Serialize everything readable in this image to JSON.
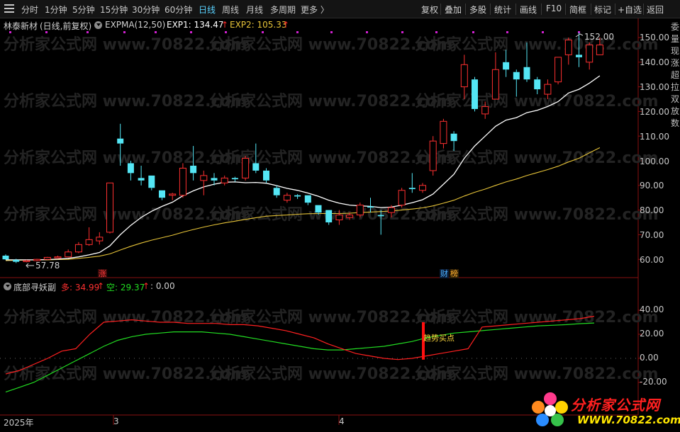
{
  "toolbar": {
    "periods": [
      {
        "label": "分时"
      },
      {
        "label": "1分钟"
      },
      {
        "label": "5分钟"
      },
      {
        "label": "15分钟"
      },
      {
        "label": "30分钟"
      },
      {
        "label": "60分钟"
      },
      {
        "label": "日线",
        "active": true
      },
      {
        "label": "周线"
      },
      {
        "label": "月线"
      },
      {
        "label": "多周期"
      },
      {
        "label": "更多 〉"
      }
    ],
    "right_buttons": [
      "复权",
      "叠加",
      "多股",
      "统计",
      "画线",
      "F10",
      "简框",
      "标记",
      "+自选",
      "返回"
    ]
  },
  "main_header": {
    "stock_name": "林泰新材",
    "mode": "(日线,前复权)",
    "indicator": "EXPMA(12,50)",
    "exp1_label": "EXP1: 134.47",
    "exp2_label": "EXP2: 105.33",
    "up_arrow": "↑"
  },
  "sub_header": {
    "name": "底部寻妖副",
    "long_label": "多: 34.99",
    "short_label": "空: 29.37",
    "signal_label": ": 0.00",
    "up_arrow": "↑"
  },
  "price_axis": [
    "150.00",
    "140.00",
    "130.00",
    "120.00",
    "110.00",
    "100.00",
    "90.00",
    "80.00",
    "70.00",
    "60.00"
  ],
  "sub_axis": [
    "40.00",
    "20.00",
    "0.00",
    "-20.00"
  ],
  "annotations": {
    "high": "152.00",
    "low": "57.78",
    "badge_zhang": "涨",
    "badge_cai": "财",
    "badge_bang": "榜",
    "signal_text": "趋势买点"
  },
  "date_axis": [
    "2025年",
    "3",
    "4"
  ],
  "watermark": "分析家公式网 www.70822.com",
  "logo": {
    "title": "分析家公式网",
    "url": "WWW.70822.com"
  },
  "side_strip": [
    "委",
    "量",
    "现",
    "涨",
    "超",
    "拉",
    "双",
    "放",
    "数"
  ],
  "colors": {
    "up": "#ff3030",
    "down": "#54e6f5",
    "exp1": "#ffffff",
    "exp2": "#e6c338",
    "long_line": "#ff2020",
    "short_line": "#22dd22",
    "signal_bar": "#ff1010",
    "active_tab": "#5ad2ff",
    "marker": "#d020d0"
  },
  "chart_data": {
    "type": "candlestick",
    "ylim": [
      55,
      156
    ],
    "candles": [
      {
        "o": 61.5,
        "c": 60.0,
        "h": 62.0,
        "l": 59.8
      },
      {
        "o": 59.8,
        "c": 59.0,
        "h": 60.2,
        "l": 58.5
      },
      {
        "o": 59.2,
        "c": 59.5,
        "h": 59.8,
        "l": 58.8
      },
      {
        "o": 59.5,
        "c": 60.0,
        "h": 60.2,
        "l": 59.2
      },
      {
        "o": 60.0,
        "c": 60.8,
        "h": 61.0,
        "l": 59.8
      },
      {
        "o": 60.8,
        "c": 61.0,
        "h": 61.5,
        "l": 60.5
      },
      {
        "o": 61.0,
        "c": 63.0,
        "h": 64.0,
        "l": 60.8
      },
      {
        "o": 63.0,
        "c": 66.0,
        "h": 67.0,
        "l": 62.5
      },
      {
        "o": 66.0,
        "c": 68.0,
        "h": 73.0,
        "l": 65.5
      },
      {
        "o": 67.5,
        "c": 69.0,
        "h": 71.0,
        "l": 66.0
      },
      {
        "o": 71.0,
        "c": 91.0,
        "h": 91.0,
        "l": 70.5
      },
      {
        "o": 109.0,
        "c": 107.0,
        "h": 115.0,
        "l": 98.0
      },
      {
        "o": 99.0,
        "c": 95.0,
        "h": 100.0,
        "l": 92.0
      },
      {
        "o": 93.0,
        "c": 92.0,
        "h": 98.0,
        "l": 90.0
      },
      {
        "o": 94.0,
        "c": 89.0,
        "h": 94.0,
        "l": 88.0
      },
      {
        "o": 88.0,
        "c": 85.0,
        "h": 88.0,
        "l": 84.0
      },
      {
        "o": 86.0,
        "c": 86.5,
        "h": 87.0,
        "l": 84.0
      },
      {
        "o": 86.0,
        "c": 97.0,
        "h": 99.0,
        "l": 85.0
      },
      {
        "o": 98.0,
        "c": 95.0,
        "h": 106.0,
        "l": 92.0
      },
      {
        "o": 92.0,
        "c": 94.0,
        "h": 96.0,
        "l": 86.0
      },
      {
        "o": 93.0,
        "c": 92.0,
        "h": 95.0,
        "l": 90.0
      },
      {
        "o": 91.0,
        "c": 93.0,
        "h": 94.0,
        "l": 90.0
      },
      {
        "o": 93.0,
        "c": 92.5,
        "h": 93.5,
        "l": 91.5
      },
      {
        "o": 93.0,
        "c": 101.0,
        "h": 102.0,
        "l": 92.0
      },
      {
        "o": 99.0,
        "c": 96.0,
        "h": 107.0,
        "l": 95.0
      },
      {
        "o": 96.0,
        "c": 92.0,
        "h": 97.0,
        "l": 91.0
      },
      {
        "o": 89.0,
        "c": 86.0,
        "h": 90.0,
        "l": 85.0
      },
      {
        "o": 84.0,
        "c": 86.0,
        "h": 87.0,
        "l": 83.0
      },
      {
        "o": 86.0,
        "c": 85.5,
        "h": 86.5,
        "l": 84.5
      },
      {
        "o": 86.0,
        "c": 83.0,
        "h": 86.0,
        "l": 82.0
      },
      {
        "o": 82.0,
        "c": 79.0,
        "h": 82.0,
        "l": 78.0
      },
      {
        "o": 80.0,
        "c": 75.0,
        "h": 80.0,
        "l": 74.0
      },
      {
        "o": 76.0,
        "c": 78.0,
        "h": 80.0,
        "l": 74.0
      },
      {
        "o": 77.0,
        "c": 78.0,
        "h": 79.0,
        "l": 76.0
      },
      {
        "o": 78.0,
        "c": 82.0,
        "h": 83.0,
        "l": 77.0
      },
      {
        "o": 81.5,
        "c": 81.0,
        "h": 85.0,
        "l": 79.0
      },
      {
        "o": 78.0,
        "c": 77.5,
        "h": 80.0,
        "l": 70.0
      },
      {
        "o": 79.0,
        "c": 81.0,
        "h": 82.0,
        "l": 77.0
      },
      {
        "o": 82.0,
        "c": 88.0,
        "h": 89.0,
        "l": 81.0
      },
      {
        "o": 89.0,
        "c": 88.5,
        "h": 95.0,
        "l": 87.0
      },
      {
        "o": 88.0,
        "c": 90.0,
        "h": 91.0,
        "l": 87.0
      },
      {
        "o": 96.0,
        "c": 108.0,
        "h": 110.0,
        "l": 94.0
      },
      {
        "o": 107.0,
        "c": 116.0,
        "h": 117.0,
        "l": 105.0
      },
      {
        "o": 111.0,
        "c": 108.0,
        "h": 112.0,
        "l": 104.0
      },
      {
        "o": 130.0,
        "c": 139.0,
        "h": 143.0,
        "l": 125.0
      },
      {
        "o": 133.0,
        "c": 121.0,
        "h": 134.0,
        "l": 120.0
      },
      {
        "o": 119.0,
        "c": 122.0,
        "h": 124.0,
        "l": 117.0
      },
      {
        "o": 125.0,
        "c": 137.0,
        "h": 144.0,
        "l": 125.0
      },
      {
        "o": 140.0,
        "c": 137.0,
        "h": 145.0,
        "l": 134.0
      },
      {
        "o": 136.0,
        "c": 133.0,
        "h": 137.0,
        "l": 126.0
      },
      {
        "o": 138.0,
        "c": 133.0,
        "h": 148.0,
        "l": 132.0
      },
      {
        "o": 133.0,
        "c": 129.0,
        "h": 134.0,
        "l": 127.0
      },
      {
        "o": 127.0,
        "c": 131.0,
        "h": 133.0,
        "l": 125.0
      },
      {
        "o": 132.0,
        "c": 142.0,
        "h": 142.0,
        "l": 131.0
      },
      {
        "o": 143.0,
        "c": 149.0,
        "h": 150.0,
        "l": 139.0
      },
      {
        "o": 143.0,
        "c": 142.0,
        "h": 152.0,
        "l": 138.0
      },
      {
        "o": 140.0,
        "c": 147.0,
        "h": 148.0,
        "l": 137.0
      },
      {
        "o": 143.0,
        "c": 147.0,
        "h": 150.0,
        "l": 143.0
      }
    ],
    "exp1": [
      59.8,
      59.8,
      59.8,
      59.8,
      59.9,
      60.1,
      60.4,
      61.0,
      61.8,
      62.8,
      65.5,
      70.0,
      73.8,
      77.0,
      79.5,
      81.5,
      83.2,
      85.8,
      87.8,
      89.4,
      90.5,
      91.3,
      91.4,
      91.1,
      91.2,
      90.9,
      89.9,
      88.8,
      88.0,
      86.9,
      85.6,
      84.0,
      82.8,
      82.0,
      81.7,
      81.5,
      81.0,
      81.2,
      82.0,
      83.0,
      84.2,
      86.5,
      90.5,
      94.5,
      101.0,
      106.0,
      110.0,
      114.0,
      116.5,
      117.5,
      119.5,
      120.5,
      122.0,
      124.0,
      127.5,
      129.0,
      131.5,
      134.47
    ],
    "exp2": [
      59.5,
      59.6,
      59.7,
      59.8,
      59.8,
      59.9,
      60.0,
      60.4,
      60.8,
      61.3,
      62.2,
      63.8,
      65.3,
      66.6,
      67.8,
      68.8,
      69.8,
      71.0,
      72.1,
      73.1,
      74.0,
      74.8,
      75.5,
      76.2,
      76.9,
      77.5,
      77.8,
      78.0,
      78.3,
      78.5,
      78.6,
      78.6,
      78.6,
      78.7,
      79.0,
      79.2,
      79.4,
      79.6,
      80.0,
      80.4,
      80.9,
      81.7,
      82.8,
      84.0,
      85.7,
      87.2,
      88.5,
      90.0,
      91.4,
      92.6,
      94.0,
      95.2,
      96.4,
      97.8,
      99.5,
      101.0,
      103.2,
      105.33
    ],
    "sub_ylim": [
      -40,
      50
    ],
    "long_line": [
      -13,
      -10,
      -5,
      0,
      6,
      8,
      20,
      30,
      31,
      32,
      31,
      30,
      30,
      29,
      29,
      29,
      28,
      28,
      27,
      25,
      23,
      20,
      17,
      12,
      8,
      4,
      2,
      0,
      -1,
      0,
      2,
      4,
      6,
      8,
      26,
      27,
      28,
      29,
      30,
      31,
      32,
      33,
      34.99
    ],
    "short_line": [
      -28,
      -24,
      -20,
      -14,
      -8,
      -2,
      4,
      10,
      15,
      18,
      20,
      21,
      22,
      22,
      22,
      21,
      20,
      18,
      16,
      14,
      12,
      10,
      8,
      7,
      7,
      8,
      9,
      10,
      12,
      14,
      17,
      19,
      21,
      22,
      23,
      24,
      25,
      26,
      27,
      27.5,
      28,
      28.8,
      29.37
    ],
    "signal": {
      "index": 35,
      "from": 6,
      "to": 30
    }
  }
}
